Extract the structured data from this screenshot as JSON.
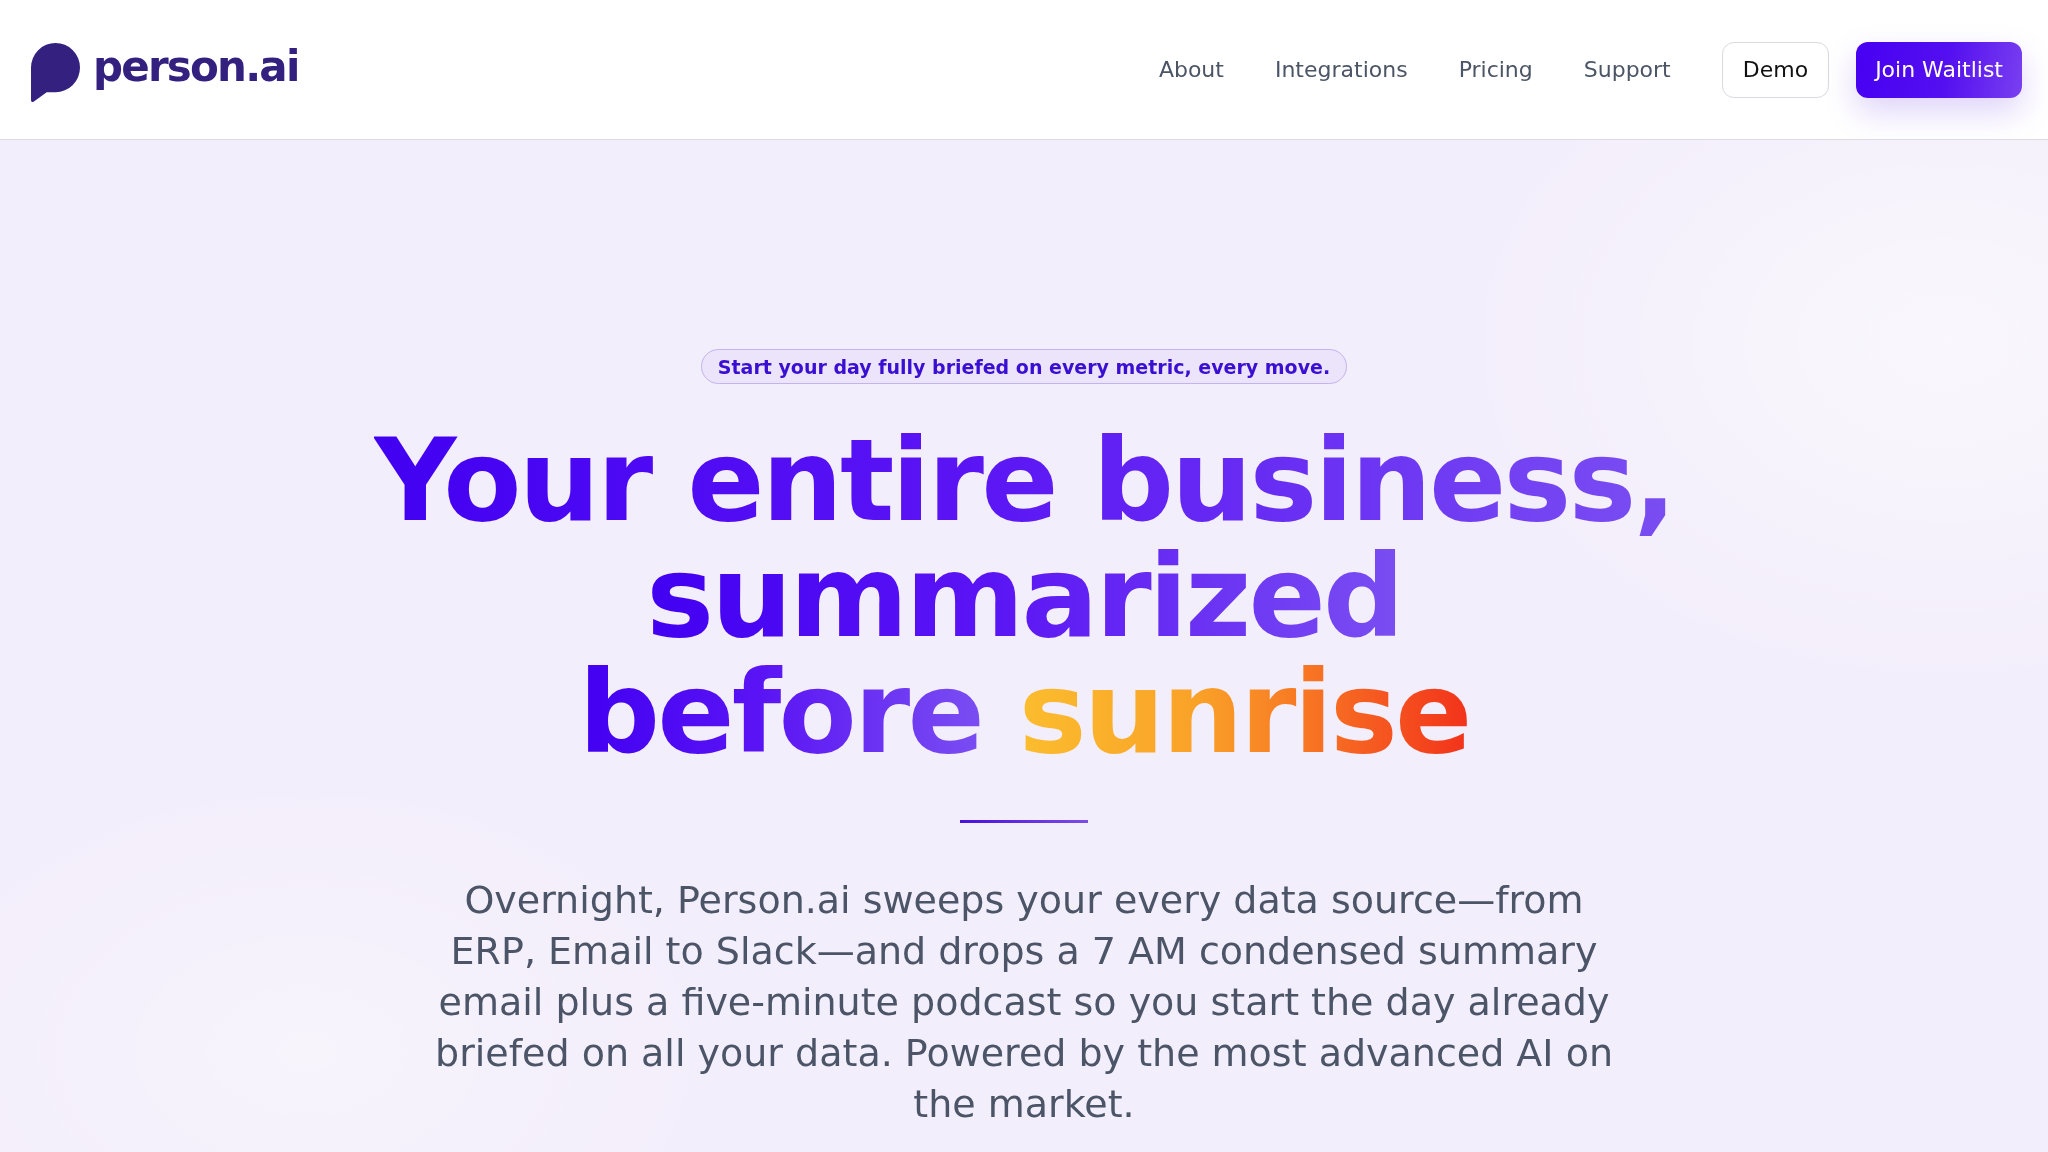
{
  "header": {
    "logo": {
      "text": "person.ai"
    },
    "nav": [
      {
        "label": "About"
      },
      {
        "label": "Integrations"
      },
      {
        "label": "Pricing"
      },
      {
        "label": "Support"
      }
    ],
    "buttons": [
      {
        "label": "Demo",
        "kind": "secondary"
      },
      {
        "label": "Join Waitlist",
        "kind": "primary"
      }
    ]
  },
  "hero": {
    "badge": "Start your day fully briefed on every metric, every move.",
    "headline": {
      "lines": [
        [
          {
            "text": "Your entire business,",
            "kind": "plain"
          }
        ],
        [
          {
            "text": "summarized",
            "kind": "plain"
          }
        ],
        [
          {
            "text": "before",
            "kind": "plain"
          },
          {
            "text": "sunrise",
            "kind": "accent"
          }
        ]
      ]
    },
    "description": "Overnight, Person.ai sweeps your every data source—from ERP, Email to Slack—and drops a 7 AM condensed summary email plus a five-minute podcast so you start the day already briefed on all your data. Powered by the most advanced AI on the market."
  }
}
